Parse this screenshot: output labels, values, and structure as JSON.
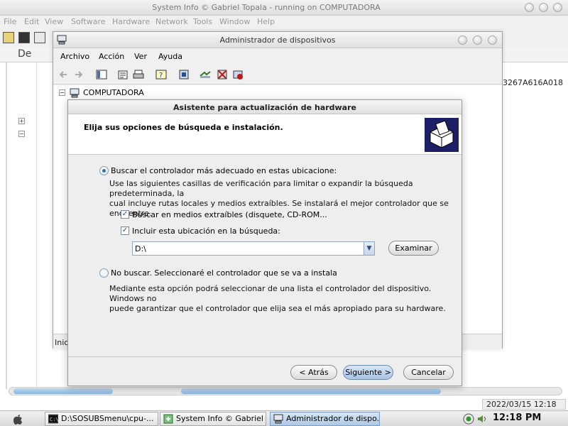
{
  "bg_app": {
    "title": "System Info  © Gabriel Topala - running on COMPUTADORA",
    "menu": [
      "File",
      "Edit",
      "View",
      "Software",
      "Hardware",
      "Network",
      "Tools",
      "Window",
      "Help"
    ],
    "heading": "De",
    "hex_id": "3267A616A018",
    "date": "2022/03/15 12:18"
  },
  "device_manager": {
    "title": "Administrador de dispositivos",
    "menu": [
      "Archivo",
      "Acción",
      "Ver",
      "Ayuda"
    ],
    "tree_root": "COMPUTADORA",
    "status_text": "Inici"
  },
  "wizard": {
    "title": "Asistente para actualización de hardware",
    "heading": "Elija sus opciones de búsqueda e instalación.",
    "option_search": {
      "label": "Buscar el controlador más adecuado en estas ubicacione:",
      "selected": true,
      "description_line1": "Use las siguientes casillas de verificación para limitar o expandir la búsqueda predeterminada, la",
      "description_line2": "cual incluye rutas locales y medios extraíbles. Se instalará el mejor controlador que se encuentre."
    },
    "check_removable": {
      "label": "Buscar en medios extraíbles (disquete, CD-ROM...",
      "checked": true
    },
    "check_location": {
      "label": "Incluir esta ubicación en la búsqueda:",
      "checked": true
    },
    "path_value": "D:\\",
    "browse_label": "Examinar",
    "option_nosearch": {
      "label": "No buscar. Seleccionaré el controlador que se va a instala",
      "selected": false,
      "description_line1": "Mediante esta opción podrá seleccionar de una lista el controlador del dispositivo. Windows no",
      "description_line2": "puede garantizar que el controlador que elija sea el más apropiado para su hardware."
    },
    "back_label": "< Atrás",
    "next_label": "Siguiente >",
    "cancel_label": "Cancelar"
  },
  "taskbar": {
    "tasks": [
      {
        "label": "D:\\SOSUBSmenu\\cpu-...",
        "active": false
      },
      {
        "label": "System Info  © Gabriel ...",
        "active": false
      },
      {
        "label": "Administrador de dispo...",
        "active": true
      }
    ],
    "clock": "12:18 PM"
  },
  "colors": {
    "wizard_icon_bg": "#1c1e66",
    "default_button": "#a9c4e4",
    "scroll_thumb": "#8ab4e0"
  }
}
